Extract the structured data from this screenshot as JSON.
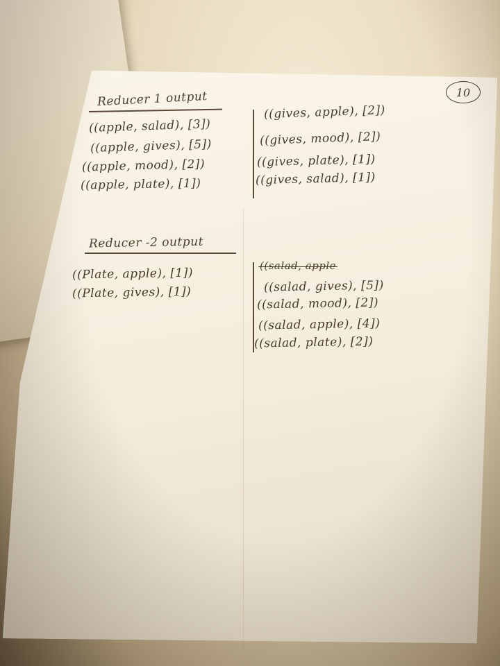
{
  "page_number": "10",
  "left_top": {
    "heading": "Reducer 1 output",
    "lines": [
      "((apple, salad), [3])",
      "((apple, gives), [5])",
      "((apple, mood), [2])",
      "((apple, plate), [1])"
    ]
  },
  "right_top": {
    "lines": [
      "((gives, apple), [2])",
      "((gives, mood), [2])",
      "((gives, plate), [1])",
      "((gives, salad), [1])"
    ]
  },
  "left_bottom": {
    "heading": "Reducer -2 output",
    "lines": [
      "((Plate, apple), [1])",
      "((Plate, gives), [1])"
    ]
  },
  "right_bottom": {
    "struck_line": "((salad, apple",
    "lines": [
      "((salad, gives), [5])",
      "((salad, mood), [2])",
      "((salad, apple), [4])",
      "((salad, plate), [2])"
    ]
  }
}
